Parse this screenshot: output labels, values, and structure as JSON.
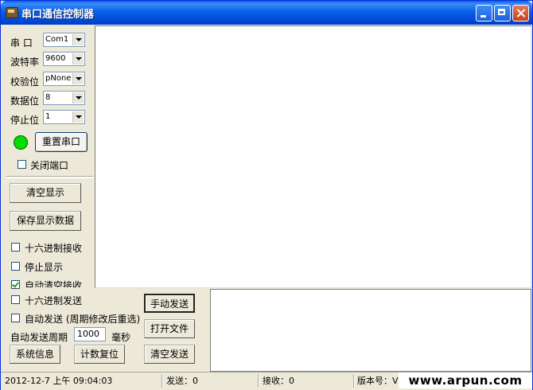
{
  "window": {
    "title": "串口通信控制器"
  },
  "config": {
    "port": {
      "label": "串  口",
      "value": "Com1"
    },
    "baud": {
      "label": "波特率",
      "value": "9600"
    },
    "parity": {
      "label": "校验位",
      "value": "pNone"
    },
    "databits": {
      "label": "数据位",
      "value": "8"
    },
    "stopbits": {
      "label": "停止位",
      "value": "1"
    }
  },
  "buttons": {
    "reset_port": "重置串口",
    "clear_display": "清空显示",
    "save_display": "保存显示数据",
    "manual_send": "手动发送",
    "open_file": "打开文件",
    "clear_send": "清空发送",
    "system_info": "系统信息",
    "count_reset": "计数复位"
  },
  "options": {
    "close_port": {
      "label": "关闭端口",
      "checked": false
    },
    "hex_receive": {
      "label": "十六进制接收",
      "checked": false
    },
    "stop_display": {
      "label": "停止显示",
      "checked": false
    },
    "auto_clear_receive": {
      "label": "自动清空接收",
      "checked": true
    },
    "hex_send": {
      "label": "十六进制发送",
      "checked": false
    },
    "auto_send": {
      "label": "自动发送 (周期修改后重选)",
      "checked": false
    }
  },
  "auto_send_period": {
    "label": "自动发送周期",
    "value": "1000",
    "unit": "毫秒"
  },
  "status_bar": {
    "datetime": "2012-12-7  上午  09:04:03",
    "sent": "发送：0",
    "received": "接收：0",
    "version": "版本号：V"
  },
  "watermark": "www.arpun.com",
  "colors": {
    "led": "#00dd00",
    "titlebar": "#0a5ce6"
  }
}
